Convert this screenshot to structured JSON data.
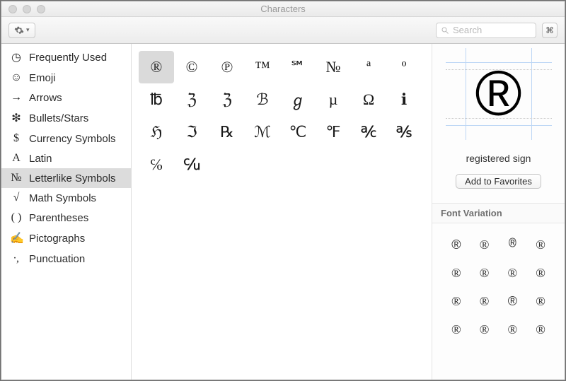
{
  "window": {
    "title": "Characters"
  },
  "toolbar": {
    "search_placeholder": "Search"
  },
  "sidebar": {
    "items": [
      {
        "icon": "clock-icon",
        "glyph": "◷",
        "label": "Frequently Used"
      },
      {
        "icon": "emoji-icon",
        "glyph": "☺",
        "label": "Emoji"
      },
      {
        "icon": "arrows-icon",
        "glyph": "→",
        "label": "Arrows"
      },
      {
        "icon": "bullets-icon",
        "glyph": "❇",
        "label": "Bullets/Stars"
      },
      {
        "icon": "currency-icon",
        "glyph": "$",
        "label": "Currency Symbols"
      },
      {
        "icon": "latin-icon",
        "glyph": "A",
        "label": "Latin"
      },
      {
        "icon": "numero-icon",
        "glyph": "№",
        "label": "Letterlike Symbols"
      },
      {
        "icon": "math-icon",
        "glyph": "√",
        "label": "Math Symbols"
      },
      {
        "icon": "parens-icon",
        "glyph": "( )",
        "label": "Parentheses"
      },
      {
        "icon": "picto-icon",
        "glyph": "✍",
        "label": "Pictographs"
      },
      {
        "icon": "punct-icon",
        "glyph": "∙,",
        "label": "Punctuation"
      }
    ],
    "selected_index": 6
  },
  "characters": {
    "selected_index": 0,
    "glyphs": [
      "®",
      "©",
      "℗",
      "™",
      "℠",
      "№",
      "ª",
      "º",
      "℔",
      "ℨ",
      "ℨ",
      "ℬ",
      "ℊ",
      "µ",
      "Ω",
      "ℹ",
      "ℌ",
      "ℑ",
      "℞",
      "ℳ",
      "℃",
      "℉",
      "℀",
      "℁",
      "℅",
      "℆"
    ]
  },
  "detail": {
    "glyph": "®",
    "name": "registered sign",
    "favorites_button": "Add to Favorites",
    "font_variation_label": "Font Variation",
    "variations": [
      "®",
      "®",
      "®",
      "®",
      "®",
      "®",
      "®",
      "®",
      "®",
      "®",
      "®",
      "®",
      "®",
      "®",
      "®",
      "®"
    ]
  }
}
